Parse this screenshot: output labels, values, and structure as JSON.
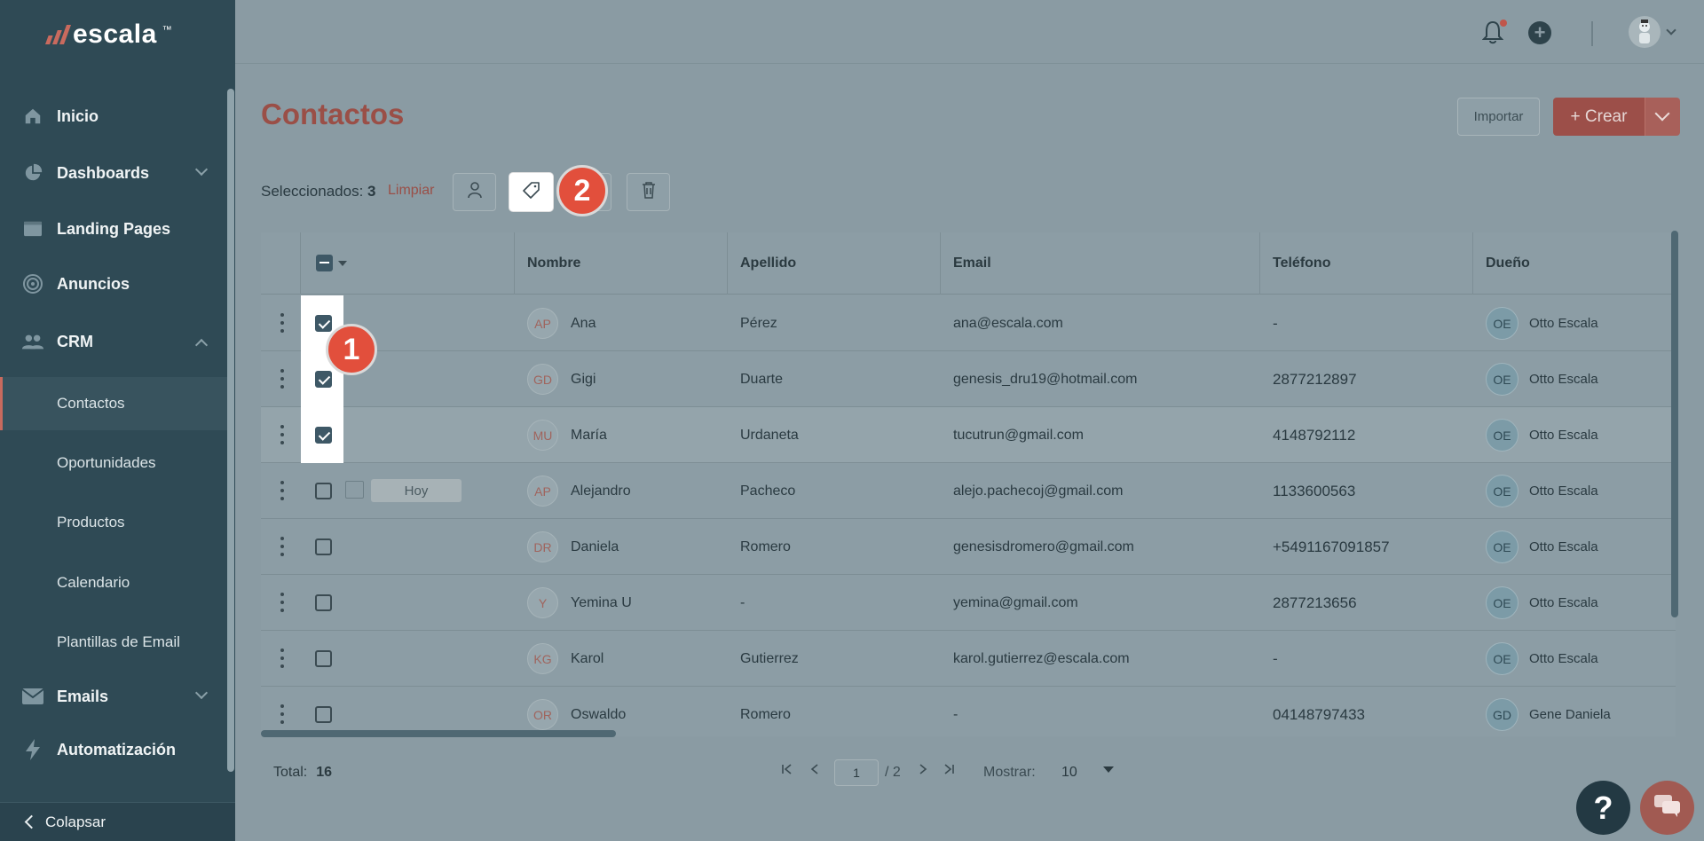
{
  "brand": {
    "name": "escala",
    "tm": "™"
  },
  "sidebar": {
    "items": [
      {
        "label": "Inicio",
        "icon": "home-icon"
      },
      {
        "label": "Dashboards",
        "icon": "pie-chart-icon",
        "expandable": true
      },
      {
        "label": "Landing Pages",
        "icon": "browser-icon"
      },
      {
        "label": "Anuncios",
        "icon": "target-icon"
      },
      {
        "label": "CRM",
        "icon": "users-icon",
        "expanded": true
      },
      {
        "label": "Emails",
        "icon": "envelope-icon",
        "expandable": true
      },
      {
        "label": "Automatización",
        "icon": "bolt-icon"
      }
    ],
    "crm_sub": [
      "Contactos",
      "Oportunidades",
      "Productos",
      "Calendario",
      "Plantillas de Email"
    ],
    "active": "Contactos",
    "collapse_label": "Colapsar"
  },
  "header": {
    "title": "Contactos",
    "import_label": "Importar",
    "create_label": "+ Crear"
  },
  "selection": {
    "label": "Seleccionados:",
    "count": "3",
    "clear_label": "Limpiar"
  },
  "annotations": {
    "badge1": "1",
    "badge2": "2"
  },
  "table": {
    "columns": [
      "Nombre",
      "Apellido",
      "Email",
      "Teléfono",
      "Dueño"
    ],
    "rows": [
      {
        "initials": "AP",
        "nombre": "Ana",
        "apellido": "Pérez",
        "email": "ana@escala.com",
        "telefono": "-",
        "owner_initials": "OE",
        "owner": "Otto Escala",
        "checked": true
      },
      {
        "initials": "GD",
        "nombre": "Gigi",
        "apellido": "Duarte",
        "email": "genesis_dru19@hotmail.com",
        "telefono": "2877212897",
        "owner_initials": "OE",
        "owner": "Otto Escala",
        "checked": true
      },
      {
        "initials": "MU",
        "nombre": "María",
        "apellido": "Urdaneta",
        "email": "tucutrun@gmail.com",
        "telefono": "4148792112",
        "owner_initials": "OE",
        "owner": "Otto Escala",
        "checked": true
      },
      {
        "initials": "AP",
        "nombre": "Alejandro",
        "apellido": "Pacheco",
        "email": "alejo.pachecoj@gmail.com",
        "telefono": "1133600563",
        "owner_initials": "OE",
        "owner": "Otto Escala",
        "checked": false,
        "tag": "Hoy"
      },
      {
        "initials": "DR",
        "nombre": "Daniela",
        "apellido": "Romero",
        "email": "genesisdromero@gmail.com",
        "telefono": "+5491167091857",
        "owner_initials": "OE",
        "owner": "Otto Escala",
        "checked": false
      },
      {
        "initials": "Y",
        "nombre": "Yemina U",
        "apellido": "-",
        "email": "yemina@gmail.com",
        "telefono": "2877213656",
        "owner_initials": "OE",
        "owner": "Otto Escala",
        "checked": false
      },
      {
        "initials": "KG",
        "nombre": "Karol",
        "apellido": "Gutierrez",
        "email": "karol.gutierrez@escala.com",
        "telefono": "-",
        "owner_initials": "OE",
        "owner": "Otto Escala",
        "checked": false
      },
      {
        "initials": "OR",
        "nombre": "Oswaldo",
        "apellido": "Romero",
        "email": "-",
        "telefono": "04148797433",
        "owner_initials": "GD",
        "owner": "Gene Daniela",
        "checked": false
      }
    ]
  },
  "footer": {
    "total_label": "Total:",
    "total": "16",
    "page": "1",
    "pages": "/ 2",
    "show_label": "Mostrar:",
    "show_value": "10"
  },
  "help_label": "?",
  "colors": {
    "accent": "#e24f3c",
    "sidebar": "#2f4a55",
    "brand": "#9a4f47"
  }
}
